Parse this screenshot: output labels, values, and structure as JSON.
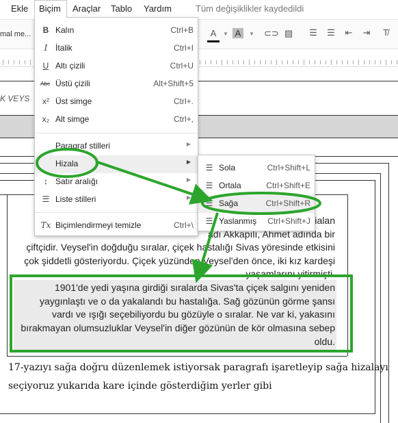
{
  "menubar": {
    "items": [
      "Ekle",
      "Biçim",
      "Araçlar",
      "Tablo",
      "Yardım"
    ],
    "status": "Tüm değişiklikler kaydedildi"
  },
  "toolbar": {
    "style_label": "mal me..."
  },
  "document": {
    "header_text": "K VEYS",
    "paragraph_lines": [
      "rialan",
      "adı Akkapılı, Ahmet adında bir",
      "çiftçidir. Veysel'in doğduğu sıralar, çiçek hastalığı Sivas yöresinde etkisini",
      "çok şiddetli gösteriyordu. Çiçek yüzünden Veysel'den önce, iki kız kardeşi",
      "yaşamlarını yitirmişti."
    ],
    "selected_lines": [
      "1901'de yedi yaşına girdiği sıralarda Sivas'ta çiçek salgını yeniden",
      "yaygınlaştı ve o da yakalandı bu hastalığa. Sağ gözünün görme şansı",
      "vardı ve ışığı seçebiliyordu bu gözüyle o sıralar. Ne var ki, yakasını",
      "bırakmayan olumsuzluklar Veysel'in diğer gözünün de kör olmasına sebep",
      "oldu."
    ],
    "caption_lines": [
      "17-yazıyı sağa doğru düzenlemek istiyorsak paragrafı işaretleyip sağa hizalayı",
      "seçiyoruz yukarıda kare içinde gösterdiğim yerler gibi"
    ]
  },
  "format_menu": {
    "items": [
      {
        "icon": "B",
        "label": "Kalın",
        "shortcut": "Ctrl+B"
      },
      {
        "icon": "I",
        "label": "İtalik",
        "shortcut": "Ctrl+I"
      },
      {
        "icon": "U",
        "label": "Altı çizili",
        "shortcut": "Ctrl+U"
      },
      {
        "icon": "Abc",
        "label": "Üstü çizili",
        "shortcut": "Alt+Shift+5"
      },
      {
        "icon": "x²",
        "label": "Üst simge",
        "shortcut": "Ctrl+."
      },
      {
        "icon": "x₂",
        "label": "Alt simge",
        "shortcut": "Ctrl+,"
      },
      {
        "icon": "",
        "label": "Paragraf stilleri",
        "shortcut": ""
      },
      {
        "icon": "",
        "label": "Hizala",
        "shortcut": ""
      },
      {
        "icon": "",
        "label": "Satır aralığı",
        "shortcut": ""
      },
      {
        "icon": "",
        "label": "Liste stilleri",
        "shortcut": ""
      },
      {
        "icon": "Tx",
        "label": "Biçimlendirmeyi temizle",
        "shortcut": "Ctrl+\\"
      }
    ]
  },
  "align_submenu": {
    "items": [
      {
        "label": "Sola",
        "shortcut": "Ctrl+Shift+L"
      },
      {
        "label": "Ortala",
        "shortcut": "Ctrl+Shift+E"
      },
      {
        "label": "Sağa",
        "shortcut": "Ctrl+Shift+R"
      },
      {
        "label": "Yaslanmış",
        "shortcut": "Ctrl+Shift+J"
      }
    ]
  },
  "colors": {
    "annotation_green": "#2ca52c",
    "selection_bg": "#eaeaea",
    "menu_highlight": "#eeeeee"
  }
}
